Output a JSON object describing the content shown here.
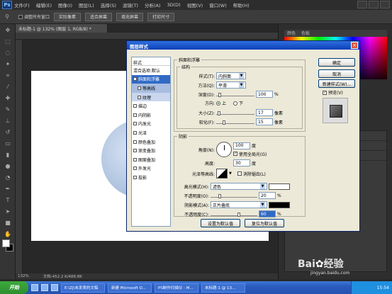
{
  "app": {
    "logo": "Ps"
  },
  "menu": [
    "文件(F)",
    "编辑(E)",
    "图像(I)",
    "图层(L)",
    "选择(S)",
    "滤镜(T)",
    "分析(A)",
    "3D(D)",
    "视图(V)",
    "窗口(W)",
    "帮助(H)"
  ],
  "options": {
    "checkbox_label": "调整所有窗口",
    "buttons": [
      "实际像素",
      "适合屏幕",
      "填充屏幕",
      "打印尺寸"
    ]
  },
  "document": {
    "tab": "未标题-1 @ 132% (图层 1, RGB/8) *"
  },
  "right_panel": {
    "tabs": [
      "颜色",
      "色板"
    ]
  },
  "statusbar": {
    "zoom": "132%",
    "doc": "文档:452.2 K/488.8K"
  },
  "dialog": {
    "title": "图层样式",
    "close": "×",
    "style_list": {
      "header": "样式",
      "items": [
        {
          "label": "混合选项:默认",
          "checkbox": false
        },
        {
          "label": "斜面和浮雕",
          "checkbox": true,
          "selected": true,
          "checked": true
        },
        {
          "label": "等高线",
          "checkbox": true,
          "sub": true
        },
        {
          "label": "纹理",
          "checkbox": true,
          "sub": true
        },
        {
          "label": "描边",
          "checkbox": true
        },
        {
          "label": "内阴影",
          "checkbox": true
        },
        {
          "label": "内发光",
          "checkbox": true
        },
        {
          "label": "光泽",
          "checkbox": true
        },
        {
          "label": "颜色叠加",
          "checkbox": true
        },
        {
          "label": "渐变叠加",
          "checkbox": true
        },
        {
          "label": "图案叠加",
          "checkbox": true
        },
        {
          "label": "外发光",
          "checkbox": true
        },
        {
          "label": "投影",
          "checkbox": true
        }
      ]
    },
    "bevel": {
      "group_title": "斜面和浮雕",
      "structure_title": "结构",
      "style_label": "样式(T):",
      "style_value": "内斜面",
      "technique_label": "方法(Q):",
      "technique_value": "平滑",
      "depth_label": "深度(D):",
      "depth_value": "100",
      "depth_unit": "%",
      "depth_level": 0.1,
      "direction_label": "方向:",
      "direction_up": "上",
      "direction_down": "下",
      "size_label": "大小(Z):",
      "size_value": "17",
      "size_unit": "像素",
      "size_level": 0.07,
      "soften_label": "软化(F):",
      "soften_value": "15",
      "soften_unit": "像素",
      "soften_level": 0.2
    },
    "shading": {
      "title": "阴影",
      "angle_label": "角度(N):",
      "angle_value": "100",
      "angle_unit": "度",
      "global_light_label": "使用全局光(G)",
      "altitude_label": "高度:",
      "altitude_value": "30",
      "altitude_unit": "度",
      "gloss_label": "光泽等高线:",
      "antialias_label": "消除锯齿(L)",
      "highlight_label": "高光模式(H):",
      "highlight_value": "滤色",
      "highlight_color": "#ffffff",
      "highlight_opacity_label": "不透明度(O):",
      "highlight_opacity_value": "20",
      "highlight_opacity_unit": "%",
      "highlight_opacity_level": 0.2,
      "shadow_label": "阴影模式(A):",
      "shadow_value": "正片叠底",
      "shadow_color": "#000000",
      "shadow_opacity_label": "不透明度(C):",
      "shadow_opacity_value": "60",
      "shadow_opacity_unit": "%",
      "shadow_opacity_level": 0.6
    },
    "footer": {
      "default_set": "设置为默认值",
      "default_reset": "复位为默认值"
    },
    "buttons": {
      "ok": "确定",
      "cancel": "取消",
      "new_style": "新建样式(W)...",
      "preview": "预览(V)"
    }
  },
  "taskbar": {
    "start": "开始",
    "items": [
      "E:\\ZJ\\未发表的文稿",
      "新建 Microsoft O...",
      "PS制作扫描仪 - M...",
      "未标题-1 @ 13...",
      "jingyan.baidu.com"
    ],
    "clock": "15:54"
  }
}
